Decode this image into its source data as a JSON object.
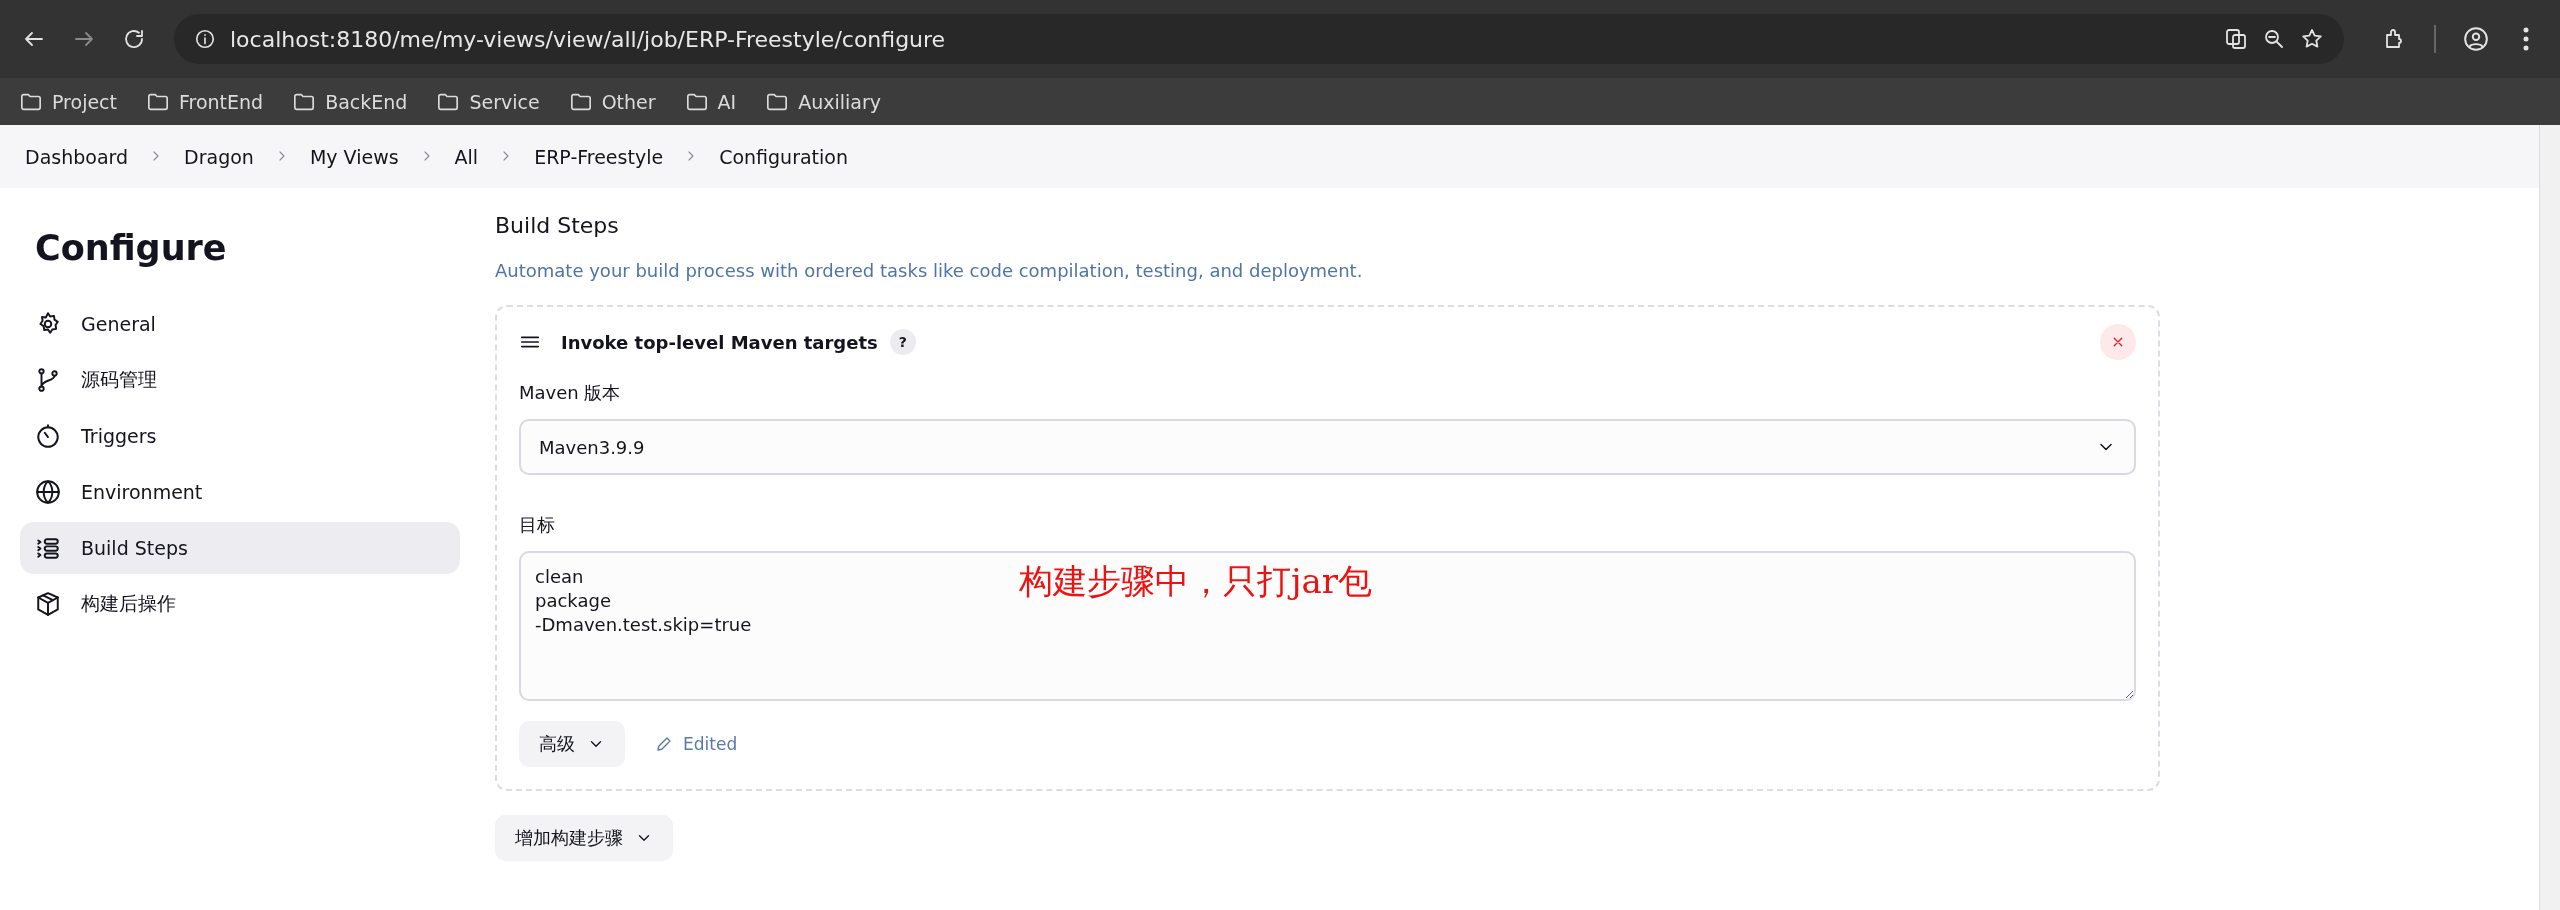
{
  "browser": {
    "url": "localhost:8180/me/my-views/view/all/job/ERP-Freestyle/configure",
    "bookmarks": [
      "Project",
      "FrontEnd",
      "BackEnd",
      "Service",
      "Other",
      "AI",
      "Auxiliary"
    ]
  },
  "breadcrumbs": [
    "Dashboard",
    "Dragon",
    "My Views",
    "All",
    "ERP-Freestyle",
    "Configuration"
  ],
  "sidebar": {
    "title": "Configure",
    "items": [
      {
        "label": "General",
        "selected": false
      },
      {
        "label": "源码管理",
        "selected": false
      },
      {
        "label": "Triggers",
        "selected": false
      },
      {
        "label": "Environment",
        "selected": false
      },
      {
        "label": "Build Steps",
        "selected": true
      },
      {
        "label": "构建后操作",
        "selected": false
      }
    ]
  },
  "section": {
    "title": "Build Steps",
    "description": "Automate your build process with ordered tasks like code compilation, testing, and deployment.",
    "step": {
      "title": "Invoke top-level Maven targets",
      "help": "?",
      "version_label": "Maven 版本",
      "version_value": "Maven3.9.9",
      "goals_label": "目标",
      "goals_value": "clean\npackage\n-Dmaven.test.skip=true",
      "annotation": "构建步骤中，只打jar包",
      "advanced_button": "高级",
      "edited_label": "Edited"
    },
    "add_button": "增加构建步骤"
  }
}
